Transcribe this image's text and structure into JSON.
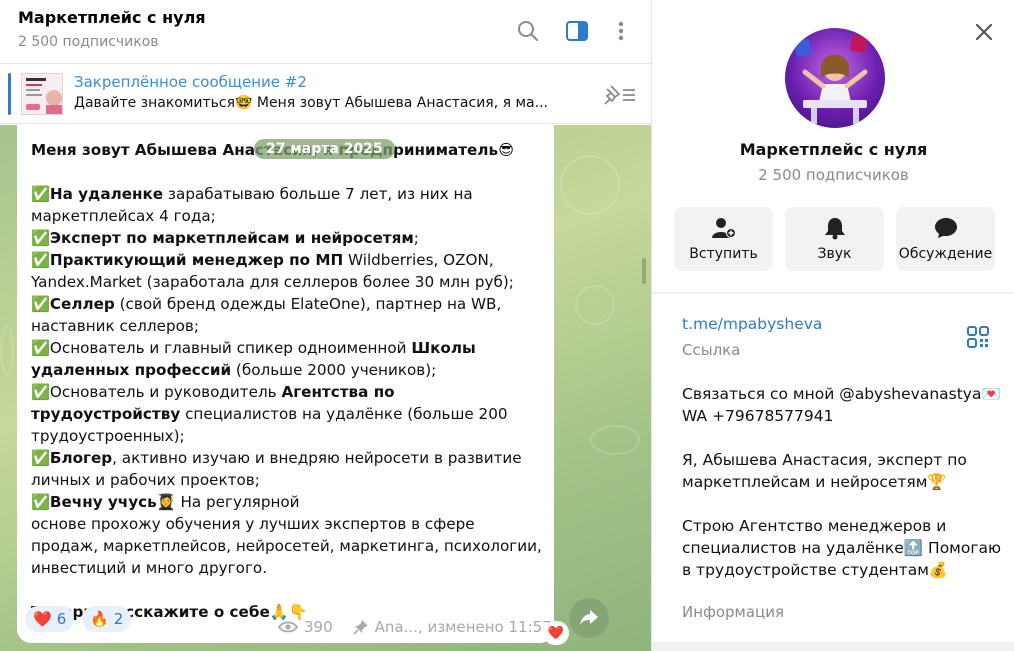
{
  "channel": {
    "title": "Маркетплейс с нуля",
    "subscribers": "2 500 подписчиков"
  },
  "header": {
    "icons": [
      "search-icon",
      "sidebar-toggle-icon",
      "more-vertical-icon"
    ]
  },
  "pinned": {
    "title": "Закреплённое сообщение #2",
    "text": "Давайте знакомиться🤓  Меня зовут Абышева Анастасия, я ма..."
  },
  "message": {
    "date": "27 марта 2025",
    "intro_bold": "Меня зовут Абышева Анастасия, я предприниматель😎",
    "p1_bold": "✅На удаленке",
    "p1": " зарабатываю больше 7 лет, из них на маркетплейсах 4 года;",
    "p2_bold": "✅Эксперт по маркетплейсам и нейросетям",
    "p2": ";",
    "p3_bold": "✅Практикующий менеджер по МП",
    "p3": " Wildberries, OZON, Yandex.Market (заработала для селлеров более 30 млн руб);",
    "p4_bold": "✅Селлер",
    "p4": " (свой бренд одежды ElateOne), партнер на WB, наставник селлеров;",
    "p5": "✅Основатель и главный спикер одноименной ",
    "p5_bold": "Школы удаленных профессий",
    "p5_end": " (больше 2000 учеников);",
    "p6": "✅Основатель и руководитель ",
    "p6_bold": "Агентства по трудоустройству",
    "p6_end": " специалистов на удалёнке (больше 200 трудоустроенных);",
    "p7_bold": "✅Блогер",
    "p7": ", активно изучаю и внедряю нейросети в развитие личных и рабочих проектов;",
    "p8_bold": "✅Вечну учусь",
    "p8": "👩‍🎓 На регулярной\nоснове прохожу обучения у лучших экспертов в сфере продаж, маркетплейсов, нейросетей, маркетинга, психологии, инвестиций и много другого.",
    "closing_bold": "Теперь, расскажите о себе🙏👇",
    "reactions": [
      {
        "emoji": "❤️",
        "count": "6"
      },
      {
        "emoji": "🔥",
        "count": "2"
      }
    ],
    "views": "390",
    "author_edit": "Ana..., изменено 11:57",
    "own_reaction": "❤️"
  },
  "info_panel": {
    "title": "Маркетплейс с нуля",
    "subscribers": "2 500 подписчиков",
    "actions": [
      {
        "label": "Вступить",
        "icon": "add-user-icon"
      },
      {
        "label": "Звук",
        "icon": "bell-icon"
      },
      {
        "label": "Обсуждение",
        "icon": "chat-bubble-icon"
      }
    ],
    "link": "t.me/mpabysheva",
    "link_caption": "Ссылка",
    "about": "Связаться со мной @abyshevanastya💌\nWA +79678577941\n\nЯ, Абышева Анастасия, эксперт по маркетплейсам и нейросетям🏆\n\nСтрою Агентство менеджеров и специалистов на удалёнке🔝 Помогаю в трудоустройстве студентам💰",
    "about_caption": "Информация"
  },
  "colors": {
    "accent": "#2c7bc7",
    "chat_bg": "#a7c48d",
    "muted": "#8a8a8a"
  }
}
